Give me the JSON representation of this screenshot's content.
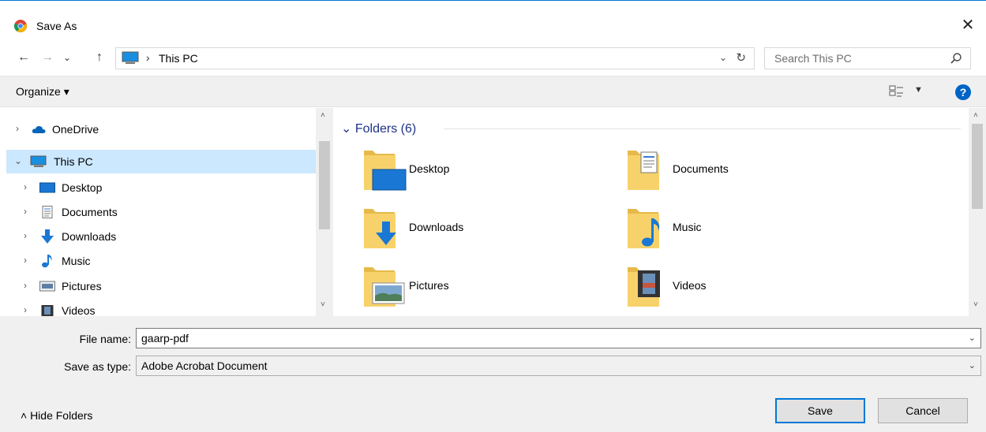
{
  "window": {
    "title": "Save As",
    "close_glyph": "✕"
  },
  "nav": {
    "back": "←",
    "forward": "→",
    "recent": "⌄",
    "up": "↑",
    "breadcrumb_sep": "›",
    "location": "This PC",
    "refresh": "↻",
    "dropdown": "⌄",
    "search_placeholder": "Search This PC"
  },
  "toolbar": {
    "organize": "Organize ▾",
    "view_dropdown": "▼",
    "help": "?"
  },
  "tree": [
    {
      "label": "OneDrive",
      "icon": "cloud-icon",
      "chevron": "›",
      "selected": false
    },
    {
      "label": "This PC",
      "icon": "computer-icon",
      "chevron": "⌄",
      "selected": true
    },
    {
      "label": "Desktop",
      "icon": "desktop-icon",
      "chevron": "›",
      "selected": false
    },
    {
      "label": "Documents",
      "icon": "documents-icon",
      "chevron": "›",
      "selected": false
    },
    {
      "label": "Downloads",
      "icon": "downloads-icon",
      "chevron": "›",
      "selected": false
    },
    {
      "label": "Music",
      "icon": "music-icon",
      "chevron": "›",
      "selected": false
    },
    {
      "label": "Pictures",
      "icon": "pictures-icon",
      "chevron": "›",
      "selected": false
    },
    {
      "label": "Videos",
      "icon": "videos-icon",
      "chevron": "›",
      "selected": false
    }
  ],
  "content": {
    "group_header": "⌄ Folders (6)",
    "folders": [
      {
        "label": "Desktop",
        "icon": "desktop-folder-icon"
      },
      {
        "label": "Documents",
        "icon": "documents-folder-icon"
      },
      {
        "label": "Downloads",
        "icon": "downloads-folder-icon"
      },
      {
        "label": "Music",
        "icon": "music-folder-icon"
      },
      {
        "label": "Pictures",
        "icon": "pictures-folder-icon"
      },
      {
        "label": "Videos",
        "icon": "videos-folder-icon"
      }
    ]
  },
  "scroll": {
    "up": "˄",
    "down": "˅"
  },
  "form": {
    "file_name_label": "File name:",
    "file_name_value": "gaarp-pdf",
    "save_type_label": "Save as type:",
    "save_type_value": "Adobe Acrobat Document",
    "dropdown": "⌄"
  },
  "footer": {
    "hide_folders": "˄  Hide Folders",
    "save": "Save",
    "cancel": "Cancel"
  },
  "colors": {
    "accent": "#0078d7",
    "selected_bg": "#cce8ff",
    "folder_yellow": "#f7d26b",
    "header_blue": "#1e3287"
  }
}
